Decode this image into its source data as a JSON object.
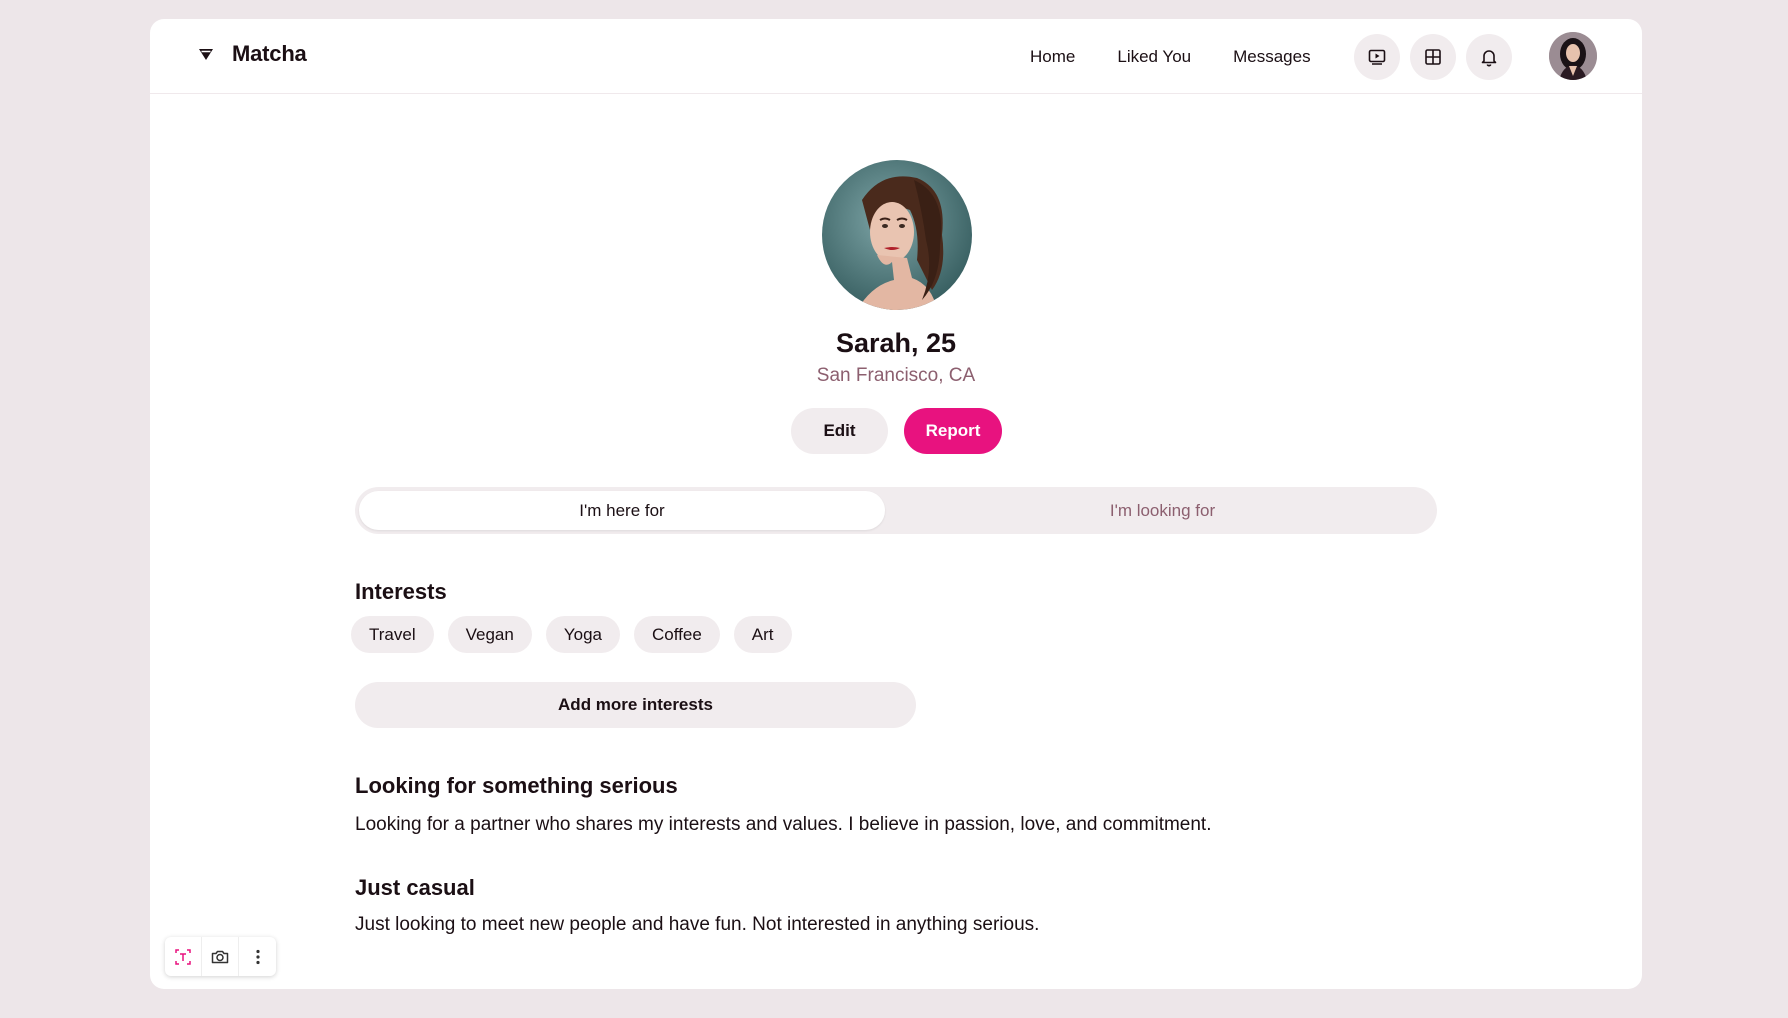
{
  "app": {
    "name": "Matcha",
    "logo_icon": "diamond-logo-icon",
    "accent_color": "#e8127f"
  },
  "nav": {
    "links": [
      {
        "label": "Home"
      },
      {
        "label": "Liked You"
      },
      {
        "label": "Messages"
      }
    ],
    "icons": [
      "video-play-icon",
      "grid-icon",
      "bell-icon"
    ],
    "avatar_icon": "user-avatar"
  },
  "profile": {
    "name": "Sarah, 25",
    "location": "San Francisco, CA",
    "edit_label": "Edit",
    "report_label": "Report"
  },
  "tabs": [
    {
      "label": "I'm here for",
      "active": true
    },
    {
      "label": "I'm looking for",
      "active": false
    }
  ],
  "interests": {
    "title": "Interests",
    "chips": [
      "Travel",
      "Vegan",
      "Yoga",
      "Coffee",
      "Art"
    ],
    "add_label": "Add more interests"
  },
  "sections": [
    {
      "title": "Looking for something serious",
      "text": "Looking for a partner who shares my interests and values. I believe in passion, love, and commitment."
    },
    {
      "title": "Just casual",
      "text": "Just looking to meet new people and have fun. Not interested in anything serious."
    }
  ],
  "toolbar": {
    "icons": [
      "text-select-icon",
      "camera-icon",
      "more-vertical-icon"
    ]
  }
}
